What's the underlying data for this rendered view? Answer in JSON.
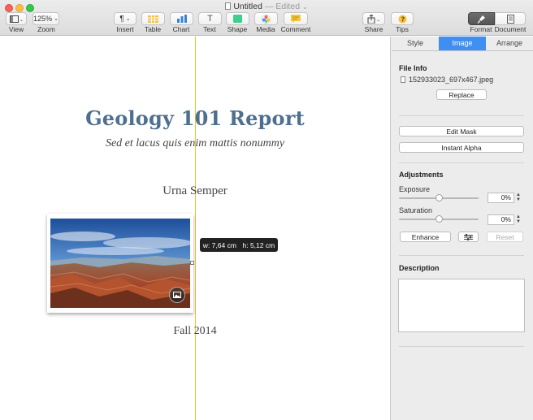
{
  "window": {
    "title": "Untitled",
    "status": "— Edited"
  },
  "toolbar": {
    "view_label": "View",
    "zoom_value": "125%",
    "zoom_label": "Zoom",
    "insert_label": "Insert",
    "table_label": "Table",
    "chart_label": "Chart",
    "text_label": "Text",
    "text_glyph": "T",
    "shape_label": "Shape",
    "media_label": "Media",
    "comment_label": "Comment",
    "share_label": "Share",
    "tips_label": "Tips",
    "format_label": "Format",
    "document_label": "Document",
    "colors": {
      "table": "#f5c242",
      "chart": "#3b82d6",
      "shape": "#3fcf8e",
      "comment": "#f7c73c",
      "tips": "#f5c242"
    }
  },
  "document": {
    "title": "Geology 101 Report",
    "subtitle": "Sed et lacus quis enim mattis nonummy",
    "author": "Urna Semper",
    "date": "Fall 2014",
    "dimension_tooltip": {
      "width": "w: 7,64 cm",
      "height": "h: 5,12 cm"
    },
    "title_color": "#4f6f8f",
    "guide_color": "#f2c230"
  },
  "inspector": {
    "tabs": [
      "Style",
      "Image",
      "Arrange"
    ],
    "active_tab": "Image",
    "file_info": {
      "heading": "File Info",
      "file_name": "152933023_697x467.jpeg",
      "replace_label": "Replace"
    },
    "edit_mask_label": "Edit Mask",
    "instant_alpha_label": "Instant Alpha",
    "adjustments": {
      "heading": "Adjustments",
      "exposure_label": "Exposure",
      "exposure_value": "0%",
      "exposure_level": 0.5,
      "saturation_label": "Saturation",
      "saturation_value": "0%",
      "saturation_level": 0.5,
      "enhance_label": "Enhance",
      "reset_label": "Reset"
    },
    "description": {
      "heading": "Description",
      "value": ""
    },
    "accent_color": "#3f8ef2"
  }
}
